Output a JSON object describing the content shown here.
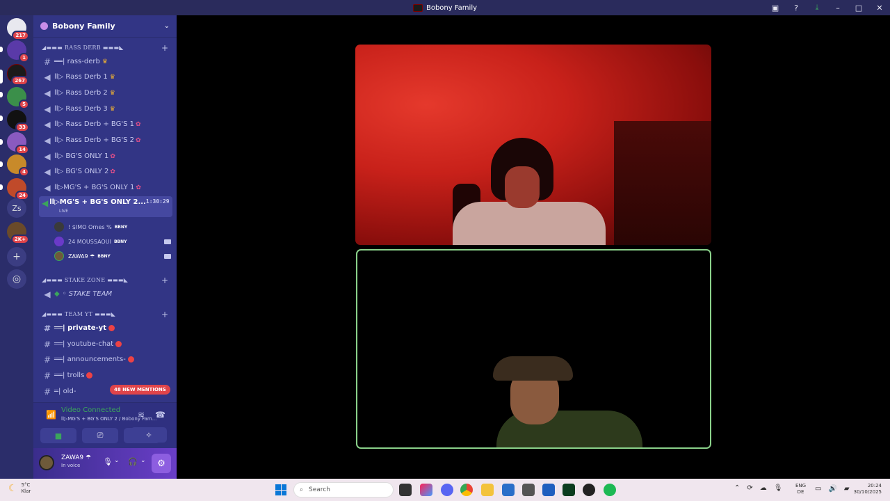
{
  "window": {
    "title": "Bobony Family"
  },
  "titlebar": {
    "icons": [
      "inbox-icon",
      "help-icon",
      "download-icon",
      "minimize-icon",
      "maximize-icon",
      "close-icon"
    ]
  },
  "servers": [
    {
      "badge": "217"
    },
    {
      "badge": "1"
    },
    {
      "badge": "267"
    },
    {
      "badge": "5"
    },
    {
      "badge": "33"
    },
    {
      "badge": "14"
    },
    {
      "badge": "4"
    },
    {
      "badge": "24"
    },
    {
      "label": "Zs"
    },
    {
      "badge": "2K+"
    }
  ],
  "guild": {
    "name": "Bobony Family"
  },
  "categories": {
    "rass": "◢▬▬▬ RASS DERB ▬▬▬◣",
    "stake": "◢▬▬▬ STAKE ZONE ▬▬▬◣",
    "team": "◢▬▬▬ TEAM YT ▬▬▬◣"
  },
  "channels": {
    "rass_derb": "══| rass-derb",
    "rass_derb_1": "ll▷ Rass Derb 1",
    "rass_derb_2": "ll▷ Rass Derb 2",
    "rass_derb_3": "ll▷ Rass Derb 3",
    "rass_derb_bgs_1": "ll▷ Rass Derb + BG'S 1",
    "rass_derb_bgs_2": "ll▷ Rass Derb + BG'S 2",
    "bgs_only_1": "ll▷ BG'S ONLY 1",
    "bgs_only_2": "ll▷ BG'S ONLY 2",
    "mgs_bgs_1": "ll▷MG'S + BG'S ONLY 1",
    "mgs_bgs_2": "ll▷MG'S + BG'S ONLY 2...",
    "mgs_bgs_2_time": "1:30:29",
    "live": "LIVE",
    "stake_team": "◦ STAKE TEAM",
    "private_yt": "══| private-yt",
    "youtube_chat": "══| youtube-chat",
    "announcements": "══| announcements-",
    "trolls": "══| trolls",
    "old": "═| old-"
  },
  "voice_users": [
    {
      "name": "! $IMO Ornes %",
      "tag": "BBNY"
    },
    {
      "name": "24 MOUSSAOUI",
      "tag": "BBNY"
    },
    {
      "name": "ZAWA9 ☂",
      "tag": "BBNY"
    }
  ],
  "mentions": "48 NEW MENTIONS",
  "voice_panel": {
    "status": "Video Connected",
    "channel": "ll▷MG'S + BG'S ONLY 2 / Bobony Fam..."
  },
  "user": {
    "name": "ZAWA9 ☂",
    "status": "In voice"
  },
  "taskbar": {
    "weather_temp": "5°C",
    "weather_desc": "Klar",
    "search_placeholder": "Search",
    "lang_1": "ENG",
    "lang_2": "DE",
    "time": "20:24",
    "date": "30/10/2025"
  },
  "colors": {
    "accent_green": "#3ba55c",
    "sidebar": "#323585",
    "mention_red": "#e0444a"
  }
}
